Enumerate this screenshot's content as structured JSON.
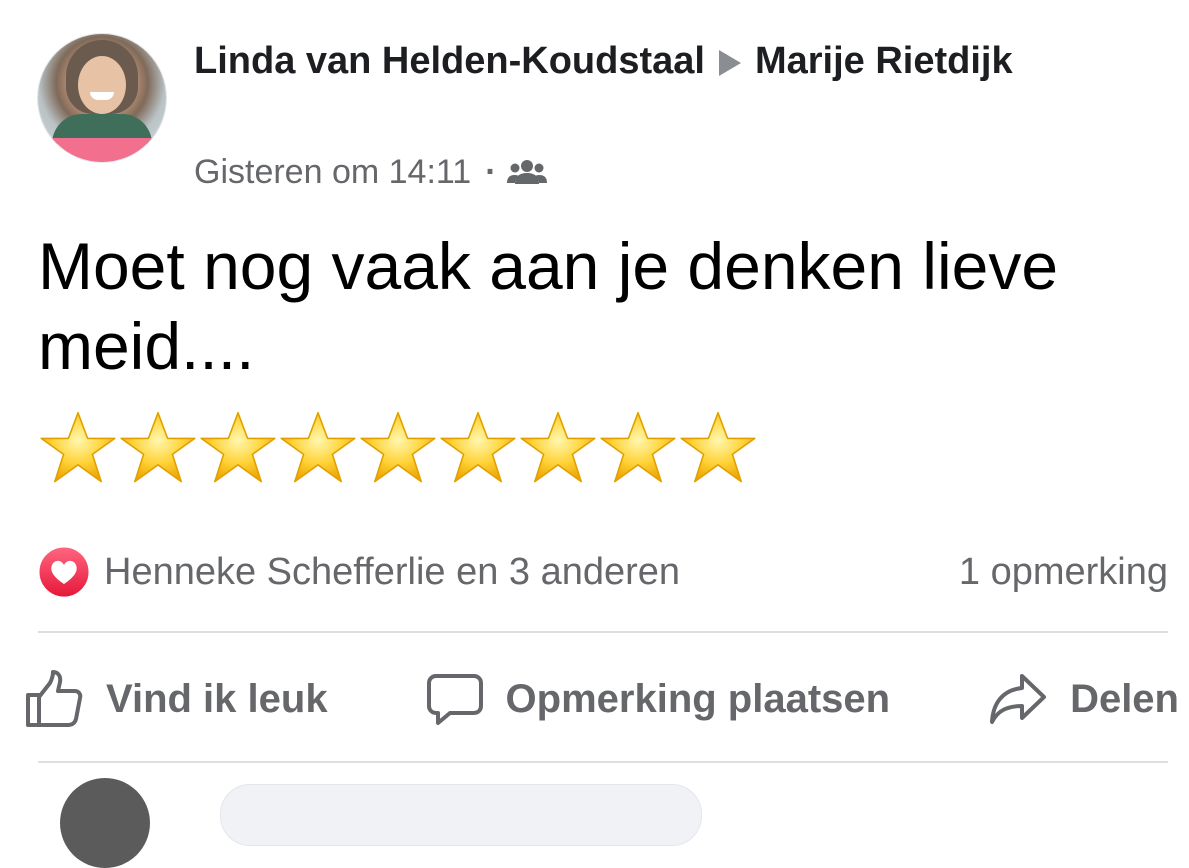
{
  "post": {
    "author": "Linda van Helden-Koudstaal",
    "recipient": "Marije Rietdijk",
    "timestamp": "Gisteren om 14:11",
    "separator": "·",
    "audience_icon": "friends-icon",
    "message": "Moet nog vaak aan je denken lieve meid....",
    "star_emoji_count": 9,
    "star_emoji": "⭐"
  },
  "reactions": {
    "icon": "love-reaction-icon",
    "summary": "Henneke Schefferlie en 3 anderen",
    "comments": "1 opmerking"
  },
  "actions": {
    "like_label": "Vind ik leuk",
    "comment_label": "Opmerking plaatsen",
    "share_label": "Delen"
  },
  "colors": {
    "text_primary": "#1c1e21",
    "text_secondary": "#65676b",
    "love_red": "#f33e58",
    "divider": "#dddfe2",
    "star_yellow": "#ffcc33"
  }
}
